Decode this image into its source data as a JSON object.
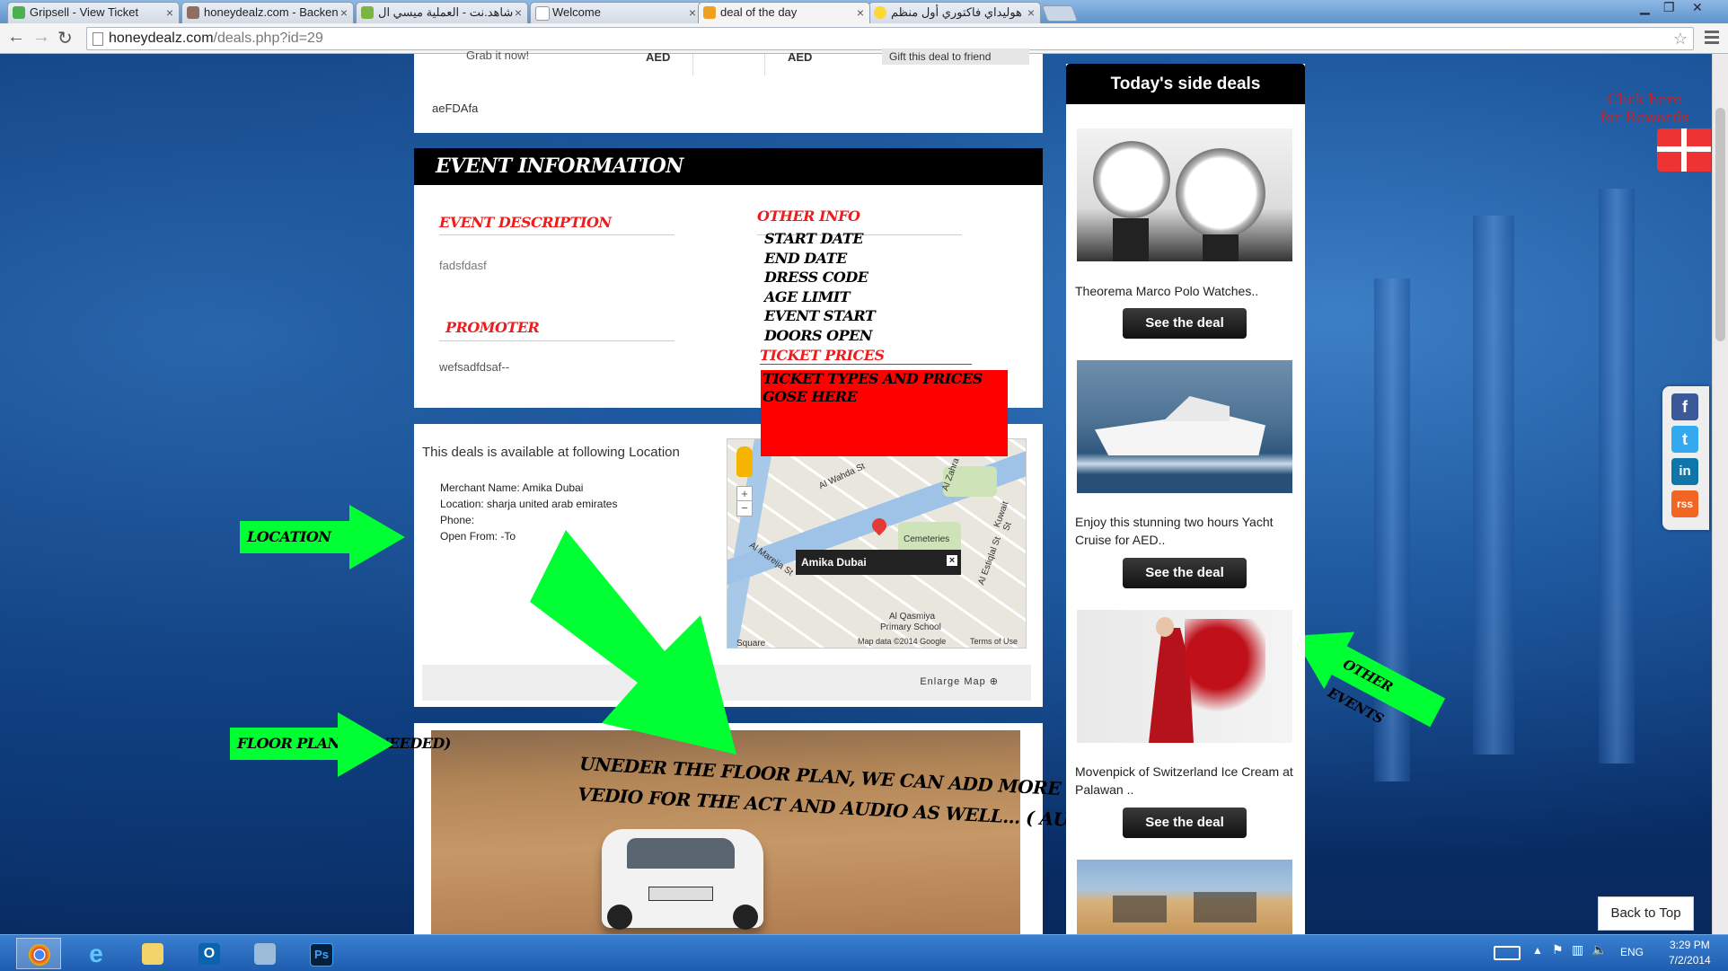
{
  "browser": {
    "tabs": [
      {
        "label": "Gripsell - View Ticket",
        "fav_color": "#4caf50"
      },
      {
        "label": "honeydealz.com - Backen",
        "fav_color": "#8d6e63"
      },
      {
        "label": "شاهد.نت - العملية ميسي ال",
        "fav_color": "#7cb342"
      },
      {
        "label": "Welcome",
        "fav_color": "#ffffff"
      },
      {
        "label": "deal of the day",
        "fav_color": "#f0a020"
      },
      {
        "label": "هوليداي فاكتوري أول منظم",
        "fav_color": "#fdd835"
      }
    ],
    "active_tab": 4,
    "url_host": "honeydealz.com",
    "url_path": "/deals.php?id=29"
  },
  "top_panel": {
    "grab_text": "Grab it now!",
    "aed_1": "AED",
    "aed_2": "AED",
    "gift_text": "Gift this deal to friend",
    "note": "aeFDAfa"
  },
  "event_info": {
    "header": "EVENT INFORMATION",
    "description_head": "EVENT DESCRIPTION",
    "description_text": "fadsfdasf",
    "promoter_head": "PROMOTER",
    "promoter_text": "wefsadfdsaf--",
    "other_info_head": "OTHER INFO",
    "other_info_items": [
      "START DATE",
      "END DATE",
      "DRESS CODE",
      "AGE LIMIT",
      "EVENT START",
      "DOORS OPEN"
    ],
    "ticket_prices_head": "TICKET PRICES",
    "ticket_prices_note": [
      "TICKET TYPES AND PRICES",
      "GOSE HERE"
    ]
  },
  "location": {
    "heading": "This deals is available at following Location",
    "merchant": "Merchant Name: Amika Dubai",
    "location": "Location: sharja united arab emirates",
    "phone": "Phone:",
    "open_from": "Open From: -To",
    "enlarge": "Enlarge Map",
    "map": {
      "info_title": "Amika Dubai",
      "close": "×",
      "zoom_in": "+",
      "zoom_out": "−",
      "labels": [
        "Cemeteries",
        "Al Qasmiya",
        "Primary School",
        "Al Mareija St",
        "Al Zahra St",
        "Al Wahda St",
        "Al Estiqlal St",
        "Kuwait St",
        "Square"
      ],
      "attribution": "Map data ©2014 Google",
      "terms": "Terms of Use"
    }
  },
  "floor_plan": {
    "overlay_line1": "UNEDER THE FLOOR PLAN, WE CAN ADD MORE PICTURE ..",
    "overlay_line2": "VEDIO FOR THE ACT AND AUDIO AS WELL... ( AUDIO PLAYER)"
  },
  "annotations": {
    "location": "LOCATION",
    "floor_plan": "FLOOR PLAN ( IF NEEDED)",
    "other_events": "OTHER EVENTS"
  },
  "sidebar": {
    "title": "Today's side deals",
    "deals": [
      {
        "title": "Theorema Marco Polo Watches..",
        "button": "See the deal"
      },
      {
        "title": "Enjoy this stunning two hours Yacht Cruise for AED..",
        "button": "See the deal"
      },
      {
        "title": "Movenpick of Switzerland Ice Cream at Palawan ..",
        "button": "See the deal"
      }
    ]
  },
  "rewards": "Click here for Rewards",
  "back_to_top": "Back to Top",
  "social": [
    "f",
    "t",
    "in",
    "rss"
  ],
  "taskbar": {
    "lang": "ENG",
    "time": "3:29 PM",
    "date": "7/2/2014",
    "apps": [
      "chrome-icon",
      "ie-icon",
      "explorer-icon",
      "outlook-icon",
      "network-icon",
      "photoshop-icon"
    ]
  },
  "colors": {
    "accent_red": "#ee1c1c",
    "arrow_green": "#00ff33",
    "panel_black": "#000000"
  }
}
